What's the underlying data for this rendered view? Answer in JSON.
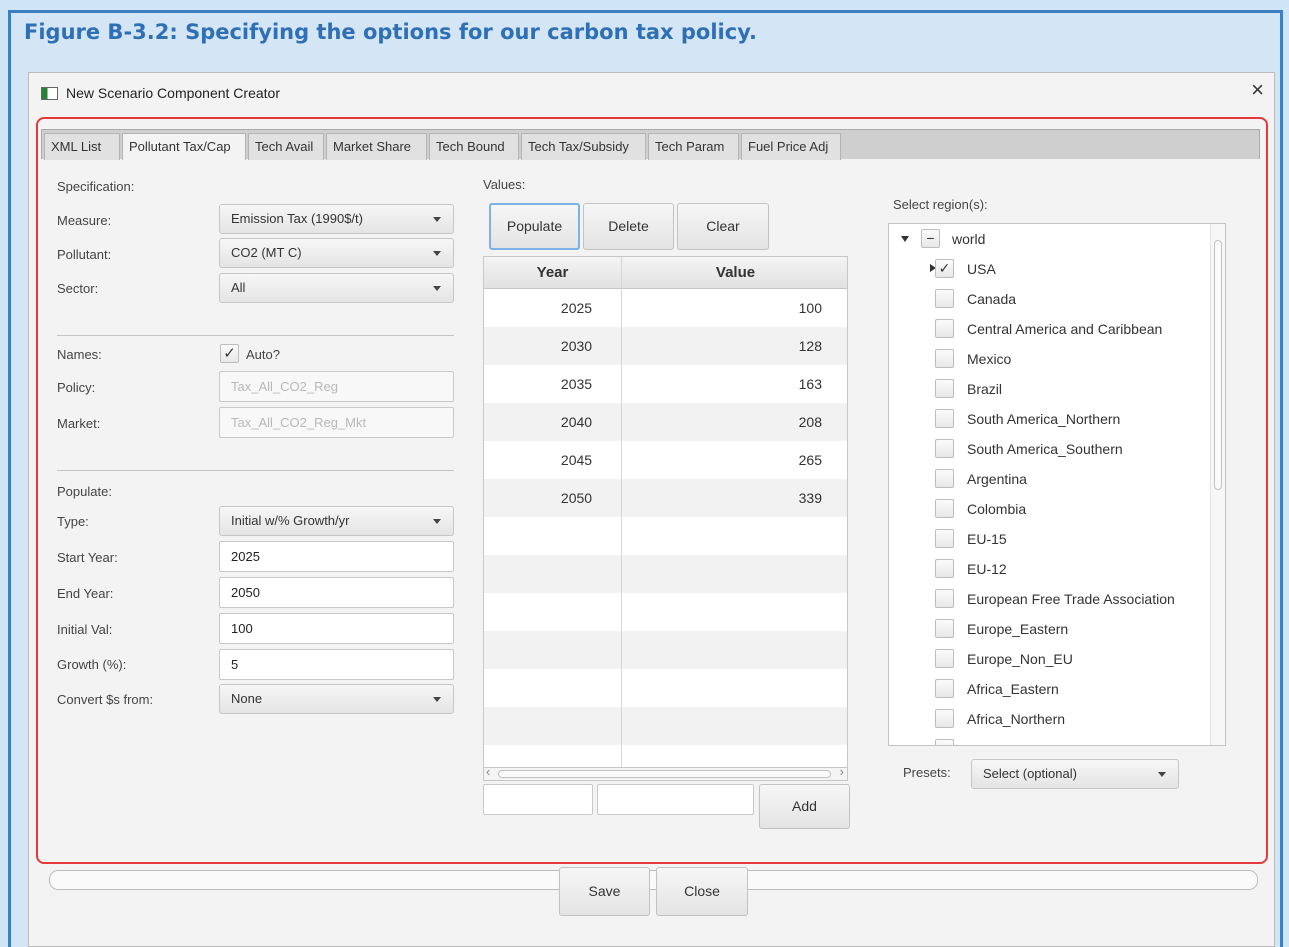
{
  "figure_title": "Figure B-3.2: Specifying the options for our carbon tax policy.",
  "window": {
    "title": "New Scenario Component Creator",
    "close_label": "×"
  },
  "tabs": [
    {
      "label": "XML List"
    },
    {
      "label": "Pollutant Tax/Cap"
    },
    {
      "label": "Tech Avail"
    },
    {
      "label": "Market Share"
    },
    {
      "label": "Tech Bound"
    },
    {
      "label": "Tech Tax/Subsidy"
    },
    {
      "label": "Tech Param"
    },
    {
      "label": "Fuel Price Adj"
    }
  ],
  "active_tab": "Pollutant Tax/Cap",
  "specification": {
    "heading": "Specification:",
    "measure_label": "Measure:",
    "measure_value": "Emission Tax (1990$/t)",
    "pollutant_label": "Pollutant:",
    "pollutant_value": "CO2 (MT C)",
    "sector_label": "Sector:",
    "sector_value": "All"
  },
  "names": {
    "label": "Names:",
    "auto_label": "Auto?",
    "auto_checked": true,
    "check_mark": "✓",
    "policy_label": "Policy:",
    "policy_value": "Tax_All_CO2_Reg",
    "market_label": "Market:",
    "market_value": "Tax_All_CO2_Reg_Mkt"
  },
  "populate": {
    "heading": "Populate:",
    "type_label": "Type:",
    "type_value": "Initial w/% Growth/yr",
    "start_year_label": "Start Year:",
    "start_year_value": "2025",
    "end_year_label": "End Year:",
    "end_year_value": "2050",
    "initial_val_label": "Initial Val:",
    "initial_val_value": "100",
    "growth_label": "Growth (%):",
    "growth_value": "5",
    "convert_label": "Convert $s from:",
    "convert_value": "None"
  },
  "values": {
    "heading": "Values:",
    "populate_button": "Populate",
    "delete_button": "Delete",
    "clear_button": "Clear",
    "col_year": "Year",
    "col_value": "Value",
    "rows": [
      {
        "year": "2025",
        "value": "100"
      },
      {
        "year": "2030",
        "value": "128"
      },
      {
        "year": "2035",
        "value": "163"
      },
      {
        "year": "2040",
        "value": "208"
      },
      {
        "year": "2045",
        "value": "265"
      },
      {
        "year": "2050",
        "value": "339"
      }
    ],
    "add_button": "Add",
    "scroll_left": "‹",
    "scroll_right": "›"
  },
  "regions": {
    "heading": "Select region(s):",
    "root": {
      "name": "world",
      "state": "partial",
      "mark": "−"
    },
    "items": [
      {
        "name": "USA",
        "checked": true,
        "mark": "✓"
      },
      {
        "name": "Canada",
        "checked": false,
        "mark": ""
      },
      {
        "name": "Central America and Caribbean",
        "checked": false,
        "mark": ""
      },
      {
        "name": "Mexico",
        "checked": false,
        "mark": ""
      },
      {
        "name": "Brazil",
        "checked": false,
        "mark": ""
      },
      {
        "name": "South America_Northern",
        "checked": false,
        "mark": ""
      },
      {
        "name": "South America_Southern",
        "checked": false,
        "mark": ""
      },
      {
        "name": "Argentina",
        "checked": false,
        "mark": ""
      },
      {
        "name": "Colombia",
        "checked": false,
        "mark": ""
      },
      {
        "name": "EU-15",
        "checked": false,
        "mark": ""
      },
      {
        "name": "EU-12",
        "checked": false,
        "mark": ""
      },
      {
        "name": "European Free Trade Association",
        "checked": false,
        "mark": ""
      },
      {
        "name": "Europe_Eastern",
        "checked": false,
        "mark": ""
      },
      {
        "name": "Europe_Non_EU",
        "checked": false,
        "mark": ""
      },
      {
        "name": "Africa_Eastern",
        "checked": false,
        "mark": ""
      },
      {
        "name": "Africa_Northern",
        "checked": false,
        "mark": ""
      }
    ],
    "presets_label": "Presets:",
    "presets_value": "Select (optional)"
  },
  "footer": {
    "save_button": "Save",
    "close_button": "Close"
  },
  "colors": {
    "figure_title": "#2f6fb5",
    "frame_border": "#3d7fc1",
    "highlight_box": "#e53a3a",
    "focus_ring": "#7cb2e5"
  }
}
